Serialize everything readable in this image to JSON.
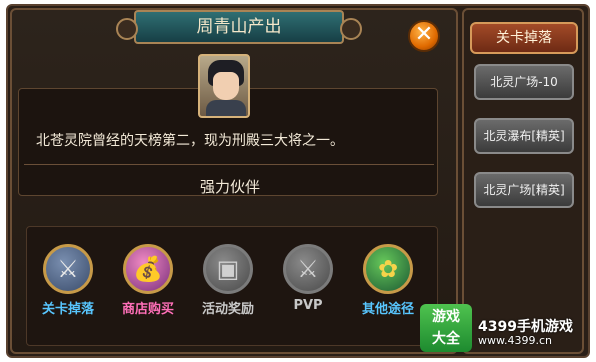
{
  "dialog": {
    "title": "周青山产出",
    "close_symbol": "✕",
    "description": "北苍灵院曾经的天榜第二，现为刑殿三大将之一。",
    "partner_label": "强力伙伴"
  },
  "sources": [
    {
      "label": "关卡掉落",
      "icon": "crossed-swords-icon",
      "glyph": "⚔",
      "state": "active"
    },
    {
      "label": "商店购买",
      "icon": "shop-bag-icon",
      "glyph": "💰",
      "state": "active"
    },
    {
      "label": "活动奖励",
      "icon": "treasure-chest-icon",
      "glyph": "▣",
      "state": "disabled"
    },
    {
      "label": "PVP",
      "icon": "pvp-swords-icon",
      "glyph": "⚔",
      "state": "disabled"
    },
    {
      "label": "其他途径",
      "icon": "peacock-feather-icon",
      "glyph": "✿",
      "state": "active"
    }
  ],
  "side_panel": {
    "header": "关卡掉落",
    "stages": [
      "北灵广场-10",
      "北灵瀑布[精英]",
      "北灵广场[精英]"
    ]
  },
  "watermark": {
    "logo_line1": "游戏",
    "logo_line2": "大全",
    "site_name": "4399手机游戏",
    "site_url": "www.4399.cn"
  }
}
